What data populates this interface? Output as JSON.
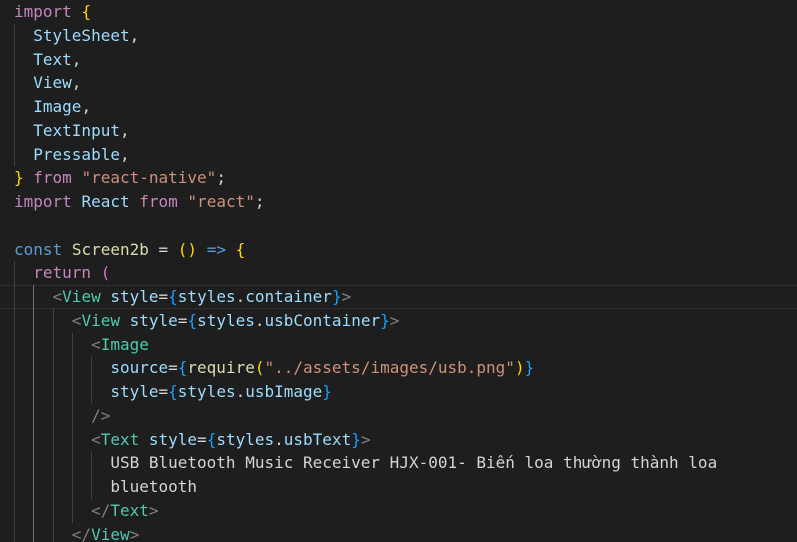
{
  "theme": {
    "background": "#1e1e1e",
    "keyword": "#c586c0",
    "storage": "#569cd6",
    "function": "#dcdcaa",
    "variable": "#9cdcfe",
    "component": "#4ec9b0",
    "string": "#ce9178",
    "tag_bracket": "#808080",
    "bracket_1": "#ffd700",
    "bracket_2": "#da70d6",
    "bracket_3": "#179fff"
  },
  "editor": {
    "lines": [
      {
        "indent": 0,
        "tokens": [
          {
            "t": "import",
            "c": "kw"
          },
          {
            "t": " ",
            "c": "op"
          },
          {
            "t": "{",
            "c": "br1"
          }
        ]
      },
      {
        "indent": 1,
        "tokens": [
          {
            "t": "StyleSheet",
            "c": "vr"
          },
          {
            "t": ",",
            "c": "op"
          }
        ]
      },
      {
        "indent": 1,
        "tokens": [
          {
            "t": "Text",
            "c": "vr"
          },
          {
            "t": ",",
            "c": "op"
          }
        ]
      },
      {
        "indent": 1,
        "tokens": [
          {
            "t": "View",
            "c": "vr"
          },
          {
            "t": ",",
            "c": "op"
          }
        ]
      },
      {
        "indent": 1,
        "tokens": [
          {
            "t": "Image",
            "c": "vr"
          },
          {
            "t": ",",
            "c": "op"
          }
        ]
      },
      {
        "indent": 1,
        "tokens": [
          {
            "t": "TextInput",
            "c": "vr"
          },
          {
            "t": ",",
            "c": "op"
          }
        ]
      },
      {
        "indent": 1,
        "tokens": [
          {
            "t": "Pressable",
            "c": "vr"
          },
          {
            "t": ",",
            "c": "op"
          }
        ]
      },
      {
        "indent": 0,
        "tokens": [
          {
            "t": "}",
            "c": "br1"
          },
          {
            "t": " ",
            "c": "op"
          },
          {
            "t": "from",
            "c": "kw"
          },
          {
            "t": " ",
            "c": "op"
          },
          {
            "t": "\"react-native\"",
            "c": "str"
          },
          {
            "t": ";",
            "c": "op"
          }
        ]
      },
      {
        "indent": 0,
        "tokens": [
          {
            "t": "import",
            "c": "kw"
          },
          {
            "t": " ",
            "c": "op"
          },
          {
            "t": "React",
            "c": "vr"
          },
          {
            "t": " ",
            "c": "op"
          },
          {
            "t": "from",
            "c": "kw"
          },
          {
            "t": " ",
            "c": "op"
          },
          {
            "t": "\"react\"",
            "c": "str"
          },
          {
            "t": ";",
            "c": "op"
          }
        ]
      },
      {
        "indent": 0,
        "tokens": []
      },
      {
        "indent": 0,
        "tokens": [
          {
            "t": "const",
            "c": "st"
          },
          {
            "t": " ",
            "c": "op"
          },
          {
            "t": "Screen2b",
            "c": "fn"
          },
          {
            "t": " = ",
            "c": "op"
          },
          {
            "t": "()",
            "c": "br1"
          },
          {
            "t": " ",
            "c": "op"
          },
          {
            "t": "=>",
            "c": "st"
          },
          {
            "t": " ",
            "c": "op"
          },
          {
            "t": "{",
            "c": "br1"
          }
        ]
      },
      {
        "indent": 1,
        "tokens": [
          {
            "t": "return",
            "c": "kw"
          },
          {
            "t": " ",
            "c": "op"
          },
          {
            "t": "(",
            "c": "br2"
          }
        ]
      },
      {
        "indent": 2,
        "current": true,
        "tokens": [
          {
            "t": "<",
            "c": "tg"
          },
          {
            "t": "View",
            "c": "id"
          },
          {
            "t": " ",
            "c": "op"
          },
          {
            "t": "style",
            "c": "vr"
          },
          {
            "t": "=",
            "c": "op"
          },
          {
            "t": "{",
            "c": "br3"
          },
          {
            "t": "styles",
            "c": "vr"
          },
          {
            "t": ".",
            "c": "op"
          },
          {
            "t": "container",
            "c": "vr"
          },
          {
            "t": "}",
            "c": "br3"
          },
          {
            "t": ">",
            "c": "tg"
          }
        ]
      },
      {
        "indent": 3,
        "tokens": [
          {
            "t": "<",
            "c": "tg"
          },
          {
            "t": "View",
            "c": "id"
          },
          {
            "t": " ",
            "c": "op"
          },
          {
            "t": "style",
            "c": "vr"
          },
          {
            "t": "=",
            "c": "op"
          },
          {
            "t": "{",
            "c": "br3"
          },
          {
            "t": "styles",
            "c": "vr"
          },
          {
            "t": ".",
            "c": "op"
          },
          {
            "t": "usbContainer",
            "c": "vr"
          },
          {
            "t": "}",
            "c": "br3"
          },
          {
            "t": ">",
            "c": "tg"
          }
        ]
      },
      {
        "indent": 4,
        "tokens": [
          {
            "t": "<",
            "c": "tg"
          },
          {
            "t": "Image",
            "c": "id"
          }
        ]
      },
      {
        "indent": 5,
        "tokens": [
          {
            "t": "source",
            "c": "vr"
          },
          {
            "t": "=",
            "c": "op"
          },
          {
            "t": "{",
            "c": "br3"
          },
          {
            "t": "require",
            "c": "fn"
          },
          {
            "t": "(",
            "c": "br1"
          },
          {
            "t": "\"../assets/images/usb.png\"",
            "c": "str"
          },
          {
            "t": ")",
            "c": "br1"
          },
          {
            "t": "}",
            "c": "br3"
          }
        ]
      },
      {
        "indent": 5,
        "tokens": [
          {
            "t": "style",
            "c": "vr"
          },
          {
            "t": "=",
            "c": "op"
          },
          {
            "t": "{",
            "c": "br3"
          },
          {
            "t": "styles",
            "c": "vr"
          },
          {
            "t": ".",
            "c": "op"
          },
          {
            "t": "usbImage",
            "c": "vr"
          },
          {
            "t": "}",
            "c": "br3"
          }
        ]
      },
      {
        "indent": 4,
        "tokens": [
          {
            "t": "/>",
            "c": "tg"
          }
        ]
      },
      {
        "indent": 4,
        "tokens": [
          {
            "t": "<",
            "c": "tg"
          },
          {
            "t": "Text",
            "c": "id"
          },
          {
            "t": " ",
            "c": "op"
          },
          {
            "t": "style",
            "c": "vr"
          },
          {
            "t": "=",
            "c": "op"
          },
          {
            "t": "{",
            "c": "br3"
          },
          {
            "t": "styles",
            "c": "vr"
          },
          {
            "t": ".",
            "c": "op"
          },
          {
            "t": "usbText",
            "c": "vr"
          },
          {
            "t": "}",
            "c": "br3"
          },
          {
            "t": ">",
            "c": "tg"
          }
        ]
      },
      {
        "indent": 5,
        "tokens": [
          {
            "t": "USB Bluetooth Music Receiver HJX-001- Biến loa thường thành loa",
            "c": "tx"
          }
        ]
      },
      {
        "indent": 5,
        "tokens": [
          {
            "t": "bluetooth",
            "c": "tx"
          }
        ]
      },
      {
        "indent": 4,
        "tokens": [
          {
            "t": "</",
            "c": "tg"
          },
          {
            "t": "Text",
            "c": "id"
          },
          {
            "t": ">",
            "c": "tg"
          }
        ]
      },
      {
        "indent": 3,
        "tokens": [
          {
            "t": "</",
            "c": "tg"
          },
          {
            "t": "View",
            "c": "id"
          },
          {
            "t": ">",
            "c": "tg"
          }
        ]
      }
    ]
  }
}
